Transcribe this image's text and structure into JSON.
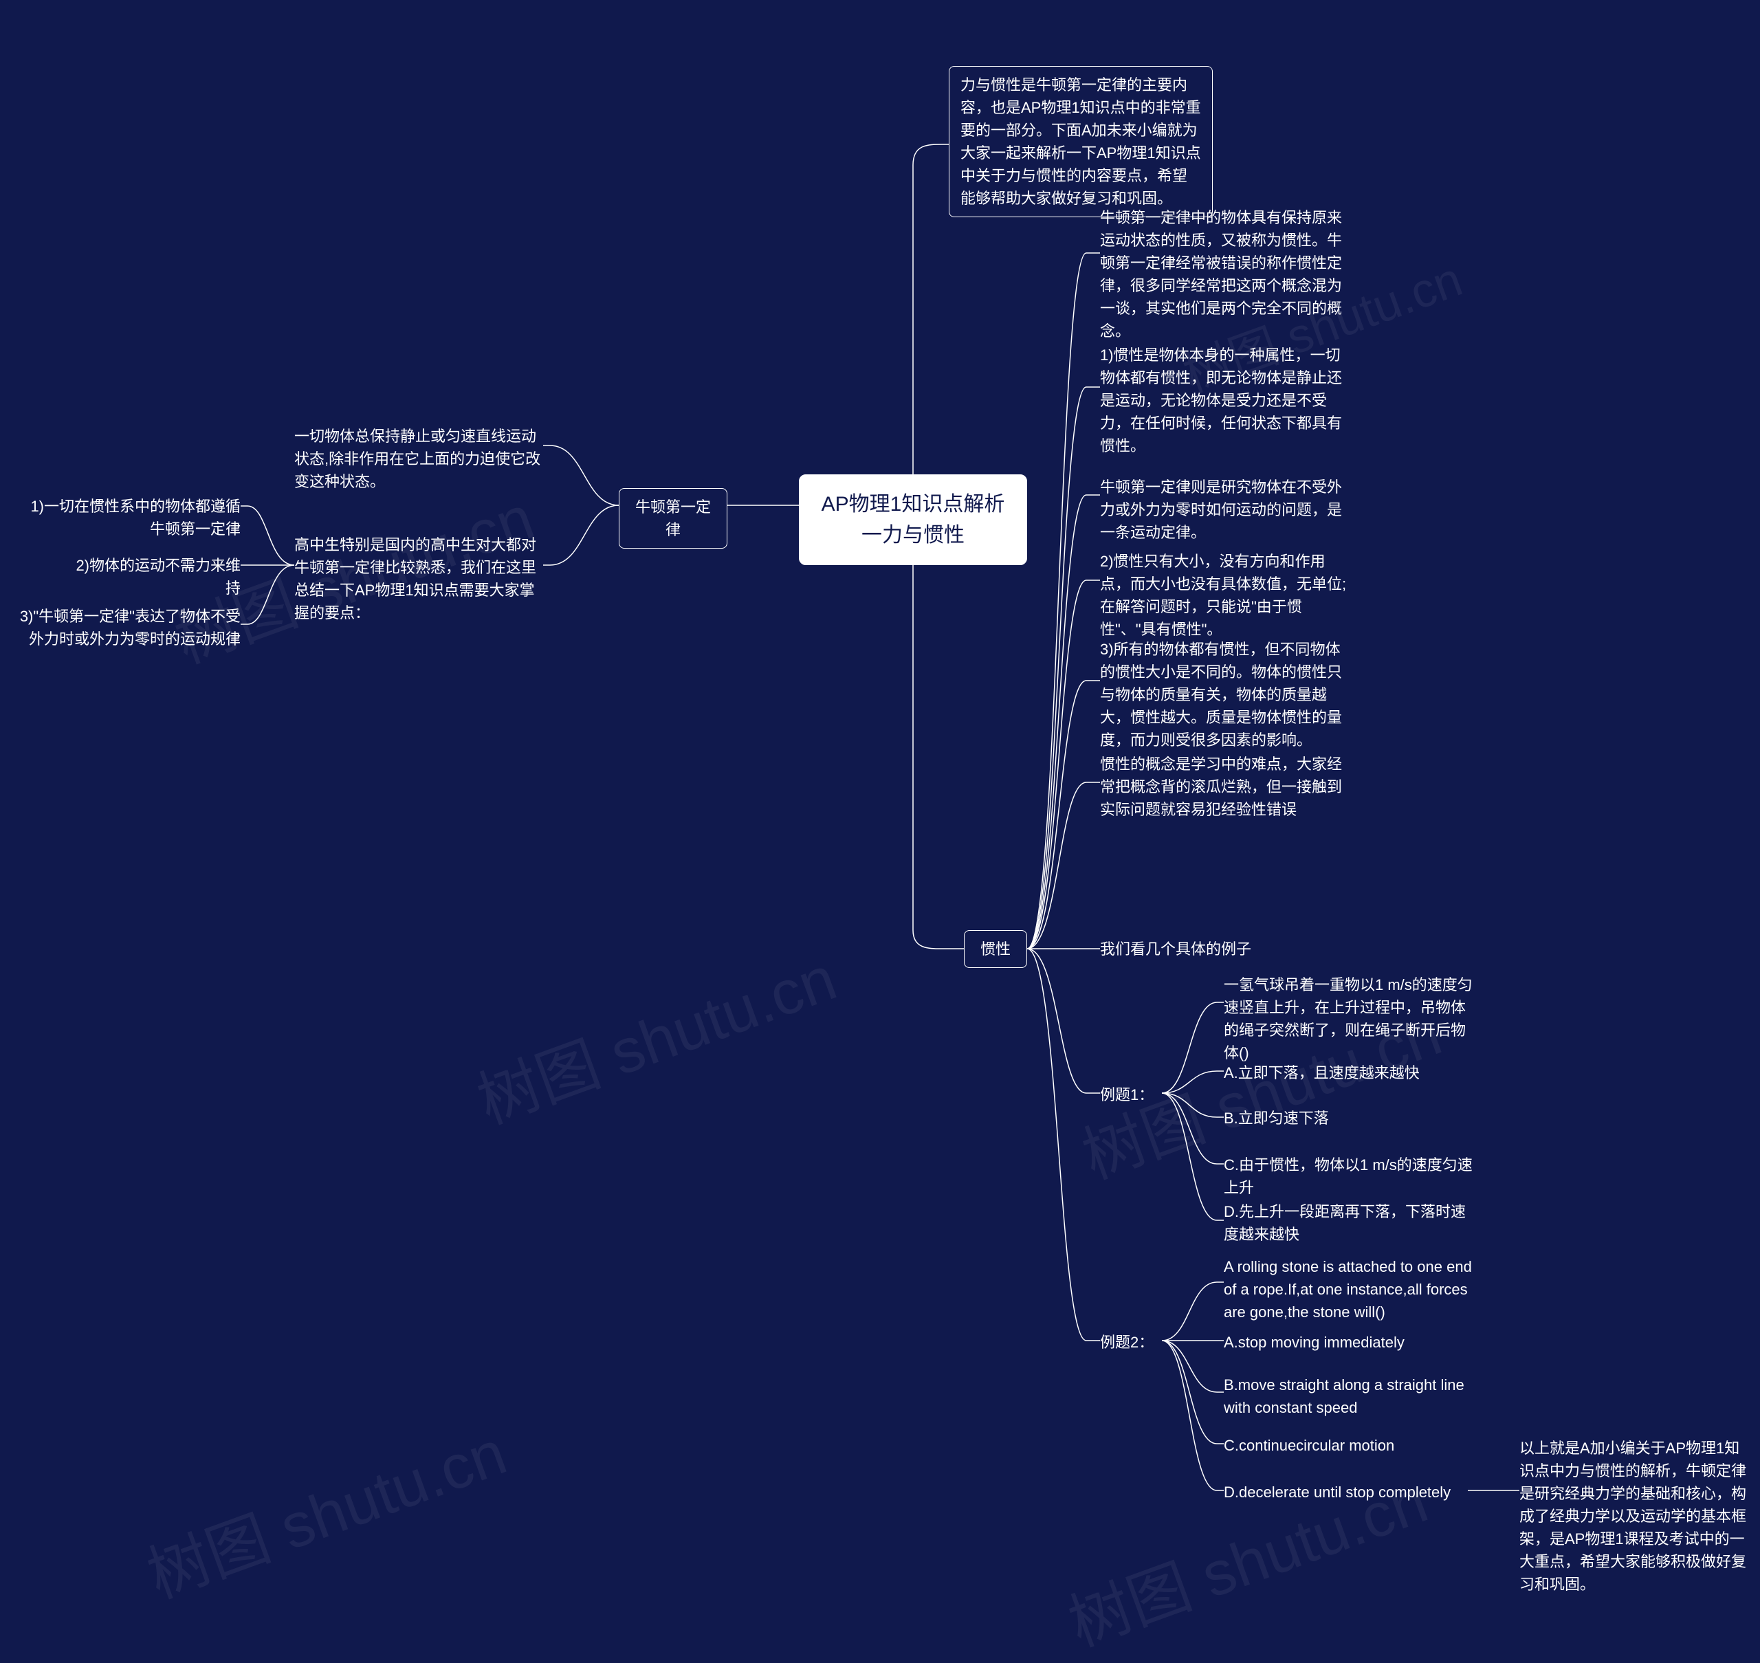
{
  "root": {
    "title": "AP物理1知识点解析一力与惯性"
  },
  "intro": "力与惯性是牛顿第一定律的主要内容，也是AP物理1知识点中的非常重要的一部分。下面A加未来小编就为大家一起来解析一下AP物理1知识点中关于力与惯性的内容要点，希望能够帮助大家做好复习和巩固。",
  "left": {
    "branch": "牛顿第一定律",
    "c1": "一切物体总保持静止或匀速直线运动状态,除非作用在它上面的力迫使它改变这种状态。",
    "c2": "高中生特别是国内的高中生对大都对牛顿第一定律比较熟悉，我们在这里总结一下AP物理1知识点需要大家掌握的要点：",
    "p1": "1)一切在惯性系中的物体都遵循牛顿第一定律",
    "p2": "2)物体的运动不需力来维持",
    "p3": "3)\"牛顿第一定律\"表达了物体不受外力时或外力为零时的运动规律"
  },
  "right": {
    "branch": "惯性",
    "t1": "牛顿第一定律中的物体具有保持原来运动状态的性质，又被称为惯性。牛顿第一定律经常被错误的称作惯性定律，很多同学经常把这两个概念混为一谈，其实他们是两个完全不同的概念。",
    "t2": "1)惯性是物体本身的一种属性，一切物体都有惯性，即无论物体是静止还是运动，无论物体是受力还是不受力，在任何时候，任何状态下都具有惯性。",
    "t3": "牛顿第一定律则是研究物体在不受外力或外力为零时如何运动的问题，是一条运动定律。",
    "t4": "2)惯性只有大小，没有方向和作用点，而大小也没有具体数值，无单位;在解答问题时，只能说\"由于惯性\"、\"具有惯性\"。",
    "t5": "3)所有的物体都有惯性，但不同物体的惯性大小是不同的。物体的惯性只与物体的质量有关，物体的质量越大，惯性越大。质量是物体惯性的量度，而力则受很多因素的影响。",
    "t6": "惯性的概念是学习中的难点，大家经常把概念背的滚瓜烂熟，但一接触到实际问题就容易犯经验性错误",
    "examplesLabel": "我们看几个具体的例子",
    "ex1": {
      "label": "例题1：",
      "q": "一氢气球吊着一重物以1 m/s的速度匀速竖直上升，在上升过程中，吊物体的绳子突然断了，则在绳子断开后物体()",
      "a": "A.立即下落，且速度越来越快",
      "b": "B.立即匀速下落",
      "c": "C.由于惯性，物体以1 m/s的速度匀速上升",
      "d": "D.先上升一段距离再下落，下落时速度越来越快"
    },
    "ex2": {
      "label": "例题2：",
      "q": "A rolling stone is attached to one end of a rope.If,at one instance,all forces are gone,the stone will()",
      "a": "A.stop moving immediately",
      "b": "B.move straight along a straight line with constant speed",
      "c": "C.continuecircular motion",
      "d": "D.decelerate until stop completely"
    },
    "conclusion": "以上就是A加小编关于AP物理1知识点中力与惯性的解析，牛顿定律是研究经典力学的基础和核心，构成了经典力学以及运动学的基本框架，是AP物理1课程及考试中的一大重点，希望大家能够积极做好复习和巩固。"
  },
  "watermark": "树图 shutu.cn"
}
